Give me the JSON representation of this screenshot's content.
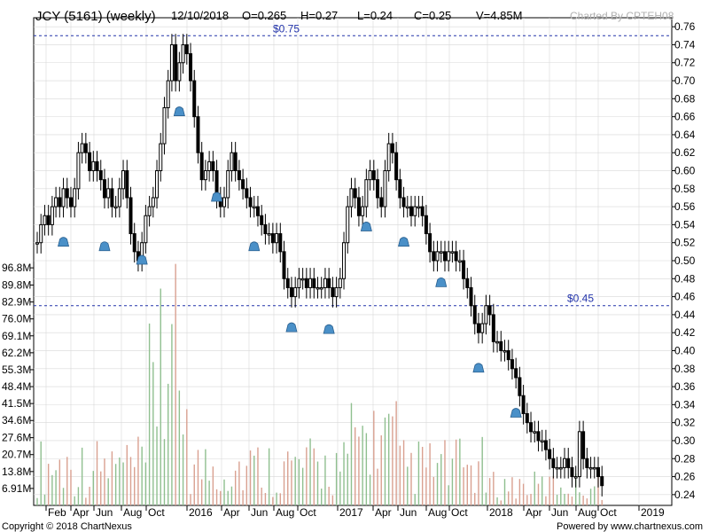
{
  "header": {
    "symbol": "JCY (5161) (weekly)",
    "date": "12/10/2018",
    "open": "O=0.265",
    "high": "H=0.27",
    "low": "L=0.24",
    "close": "C=0.25",
    "volume": "V=4.85M",
    "charted_by": "Charted By CPTEH08"
  },
  "footer": {
    "copyright": "Copyright © 2018 ChartNexus",
    "powered_by": "Powered by www.chartnexus.com"
  },
  "colors": {
    "candle": "#000000",
    "volume_up": "#8fbf8f",
    "volume_down": "#d9a090",
    "grid": "#d8d8d8",
    "ref_line": "#2233aa",
    "marker": "#4a90c8"
  },
  "chart_data": {
    "type": "candlestick",
    "x_ticks": [
      "Feb",
      "Apr",
      "Jun",
      "Aug",
      "Oct",
      "2016",
      "Apr",
      "Jun",
      "Aug",
      "Oct",
      "2017",
      "Apr",
      "Jun",
      "Aug",
      "Oct",
      "2018",
      "Apr",
      "Jun",
      "Aug",
      "Oct",
      "2019"
    ],
    "price_ticks": [
      "0.76",
      "0.74",
      "0.72",
      "0.70",
      "0.68",
      "0.66",
      "0.64",
      "0.62",
      "0.60",
      "0.58",
      "0.56",
      "0.54",
      "0.52",
      "0.50",
      "0.48",
      "0.46",
      "0.44",
      "0.42",
      "0.40",
      "0.38",
      "0.36",
      "0.34",
      "0.32",
      "0.30",
      "0.28",
      "0.26",
      "0.24"
    ],
    "price_range": [
      0.23,
      0.77
    ],
    "volume_ticks": [
      "96.8M",
      "89.8M",
      "82.9M",
      "76.0M",
      "69.1M",
      "62.2M",
      "55.3M",
      "48.4M",
      "41.5M",
      "34.6M",
      "27.6M",
      "20.7M",
      "13.8M",
      "6.91M"
    ],
    "volume_range": [
      0,
      103.7
    ],
    "reference_lines": [
      {
        "label": "$0.75",
        "value": 0.75
      },
      {
        "label": "$0.45",
        "value": 0.45
      }
    ],
    "price_series": [
      [
        0,
        0.52
      ],
      [
        2,
        0.54
      ],
      [
        3,
        0.55
      ],
      [
        4,
        0.54
      ],
      [
        5,
        0.56
      ],
      [
        6,
        0.57
      ],
      [
        7,
        0.56
      ],
      [
        8,
        0.58
      ],
      [
        9,
        0.57
      ],
      [
        10,
        0.56
      ],
      [
        11,
        0.58
      ],
      [
        12,
        0.62
      ],
      [
        13,
        0.63
      ],
      [
        14,
        0.62
      ],
      [
        15,
        0.6
      ],
      [
        16,
        0.61
      ],
      [
        17,
        0.6
      ],
      [
        18,
        0.59
      ],
      [
        19,
        0.57
      ],
      [
        20,
        0.58
      ],
      [
        21,
        0.56
      ],
      [
        22,
        0.56
      ],
      [
        23,
        0.58
      ],
      [
        24,
        0.6
      ],
      [
        25,
        0.57
      ],
      [
        26,
        0.53
      ],
      [
        27,
        0.51
      ],
      [
        28,
        0.5
      ],
      [
        29,
        0.52
      ],
      [
        30,
        0.55
      ],
      [
        31,
        0.56
      ],
      [
        32,
        0.57
      ],
      [
        33,
        0.6
      ],
      [
        34,
        0.63
      ],
      [
        35,
        0.67
      ],
      [
        36,
        0.7
      ],
      [
        37,
        0.74
      ],
      [
        38,
        0.7
      ],
      [
        39,
        0.72
      ],
      [
        40,
        0.74
      ],
      [
        41,
        0.73
      ],
      [
        42,
        0.7
      ],
      [
        43,
        0.66
      ],
      [
        44,
        0.62
      ],
      [
        45,
        0.59
      ],
      [
        46,
        0.6
      ],
      [
        47,
        0.61
      ],
      [
        48,
        0.6
      ],
      [
        49,
        0.57
      ],
      [
        50,
        0.56
      ],
      [
        51,
        0.57
      ],
      [
        52,
        0.6
      ],
      [
        53,
        0.62
      ],
      [
        54,
        0.6
      ],
      [
        55,
        0.59
      ],
      [
        56,
        0.58
      ],
      [
        57,
        0.57
      ],
      [
        58,
        0.56
      ],
      [
        59,
        0.56
      ],
      [
        60,
        0.55
      ],
      [
        61,
        0.54
      ],
      [
        62,
        0.53
      ],
      [
        63,
        0.53
      ],
      [
        64,
        0.52
      ],
      [
        65,
        0.53
      ],
      [
        66,
        0.51
      ],
      [
        67,
        0.48
      ],
      [
        68,
        0.47
      ],
      [
        69,
        0.46
      ],
      [
        70,
        0.47
      ],
      [
        71,
        0.48
      ],
      [
        72,
        0.48
      ],
      [
        73,
        0.47
      ],
      [
        74,
        0.48
      ],
      [
        75,
        0.47
      ],
      [
        76,
        0.47
      ],
      [
        77,
        0.47
      ],
      [
        78,
        0.48
      ],
      [
        79,
        0.47
      ],
      [
        80,
        0.46
      ],
      [
        81,
        0.47
      ],
      [
        82,
        0.48
      ],
      [
        83,
        0.52
      ],
      [
        84,
        0.56
      ],
      [
        85,
        0.58
      ],
      [
        86,
        0.57
      ],
      [
        87,
        0.55
      ],
      [
        88,
        0.56
      ],
      [
        89,
        0.59
      ],
      [
        90,
        0.6
      ],
      [
        91,
        0.59
      ],
      [
        92,
        0.57
      ],
      [
        93,
        0.56
      ],
      [
        94,
        0.6
      ],
      [
        95,
        0.63
      ],
      [
        96,
        0.62
      ],
      [
        97,
        0.59
      ],
      [
        98,
        0.57
      ],
      [
        99,
        0.56
      ],
      [
        100,
        0.56
      ],
      [
        101,
        0.55
      ],
      [
        102,
        0.56
      ],
      [
        103,
        0.56
      ],
      [
        104,
        0.55
      ],
      [
        105,
        0.53
      ],
      [
        106,
        0.51
      ],
      [
        107,
        0.5
      ],
      [
        108,
        0.51
      ],
      [
        109,
        0.51
      ],
      [
        110,
        0.5
      ],
      [
        111,
        0.51
      ],
      [
        112,
        0.51
      ],
      [
        113,
        0.5
      ],
      [
        114,
        0.5
      ],
      [
        115,
        0.48
      ],
      [
        116,
        0.47
      ],
      [
        117,
        0.45
      ],
      [
        118,
        0.43
      ],
      [
        119,
        0.42
      ],
      [
        120,
        0.43
      ],
      [
        121,
        0.45
      ],
      [
        122,
        0.44
      ],
      [
        123,
        0.41
      ],
      [
        124,
        0.41
      ],
      [
        125,
        0.4
      ],
      [
        126,
        0.4
      ],
      [
        127,
        0.39
      ],
      [
        128,
        0.38
      ],
      [
        129,
        0.37
      ],
      [
        130,
        0.35
      ],
      [
        131,
        0.33
      ],
      [
        132,
        0.32
      ],
      [
        133,
        0.31
      ],
      [
        134,
        0.31
      ],
      [
        135,
        0.3
      ],
      [
        136,
        0.3
      ],
      [
        137,
        0.29
      ],
      [
        138,
        0.28
      ],
      [
        139,
        0.27
      ],
      [
        140,
        0.27
      ],
      [
        141,
        0.27
      ],
      [
        142,
        0.28
      ],
      [
        143,
        0.27
      ],
      [
        144,
        0.26
      ],
      [
        145,
        0.26
      ],
      [
        146,
        0.31
      ],
      [
        147,
        0.28
      ],
      [
        148,
        0.27
      ],
      [
        149,
        0.27
      ],
      [
        150,
        0.27
      ],
      [
        151,
        0.26
      ],
      [
        152,
        0.25
      ]
    ]
  }
}
